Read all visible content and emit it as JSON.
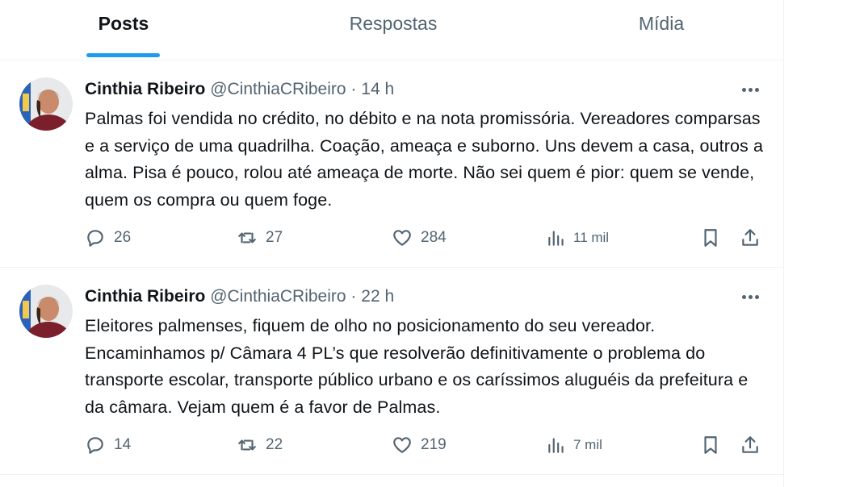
{
  "tabs": [
    {
      "label": "Posts",
      "active": true
    },
    {
      "label": "Respostas",
      "active": false
    },
    {
      "label": "Mídia",
      "active": false
    }
  ],
  "colors": {
    "accent": "#1d9bf0",
    "text_primary": "#0f1419",
    "text_secondary": "#536471"
  },
  "tweets": [
    {
      "name": "Cinthia Ribeiro",
      "handle": "@CinthiaCRibeiro",
      "separator": "·",
      "time": "14 h",
      "text": "Palmas foi vendida no crédito, no débito e na nota promissória. Vereadores comparsas e a serviço de uma quadrilha. Coação, ameaça e suborno. Uns devem a casa, outros a alma. Pisa é pouco, rolou até ameaça de morte. Não sei quem é pior: quem se vende, quem os compra ou quem foge.",
      "replies": "26",
      "retweets": "27",
      "likes": "284",
      "views": "11 mil"
    },
    {
      "name": "Cinthia Ribeiro",
      "handle": "@CinthiaCRibeiro",
      "separator": "·",
      "time": "22 h",
      "text": "Eleitores palmenses, fiquem de olho no posicionamento do seu vereador. Encaminhamos p/ Câmara 4 PL’s que resolverão definitivamente o problema do transporte escolar, transporte público urbano e os caríssimos aluguéis da prefeitura e da câmara. Vejam quem é a favor de Palmas.",
      "replies": "14",
      "retweets": "22",
      "likes": "219",
      "views": "7 mil"
    }
  ],
  "icons": {
    "more": "more-icon",
    "reply": "reply-icon",
    "retweet": "retweet-icon",
    "like": "heart-icon",
    "views": "views-icon",
    "bookmark": "bookmark-icon",
    "share": "share-icon"
  }
}
